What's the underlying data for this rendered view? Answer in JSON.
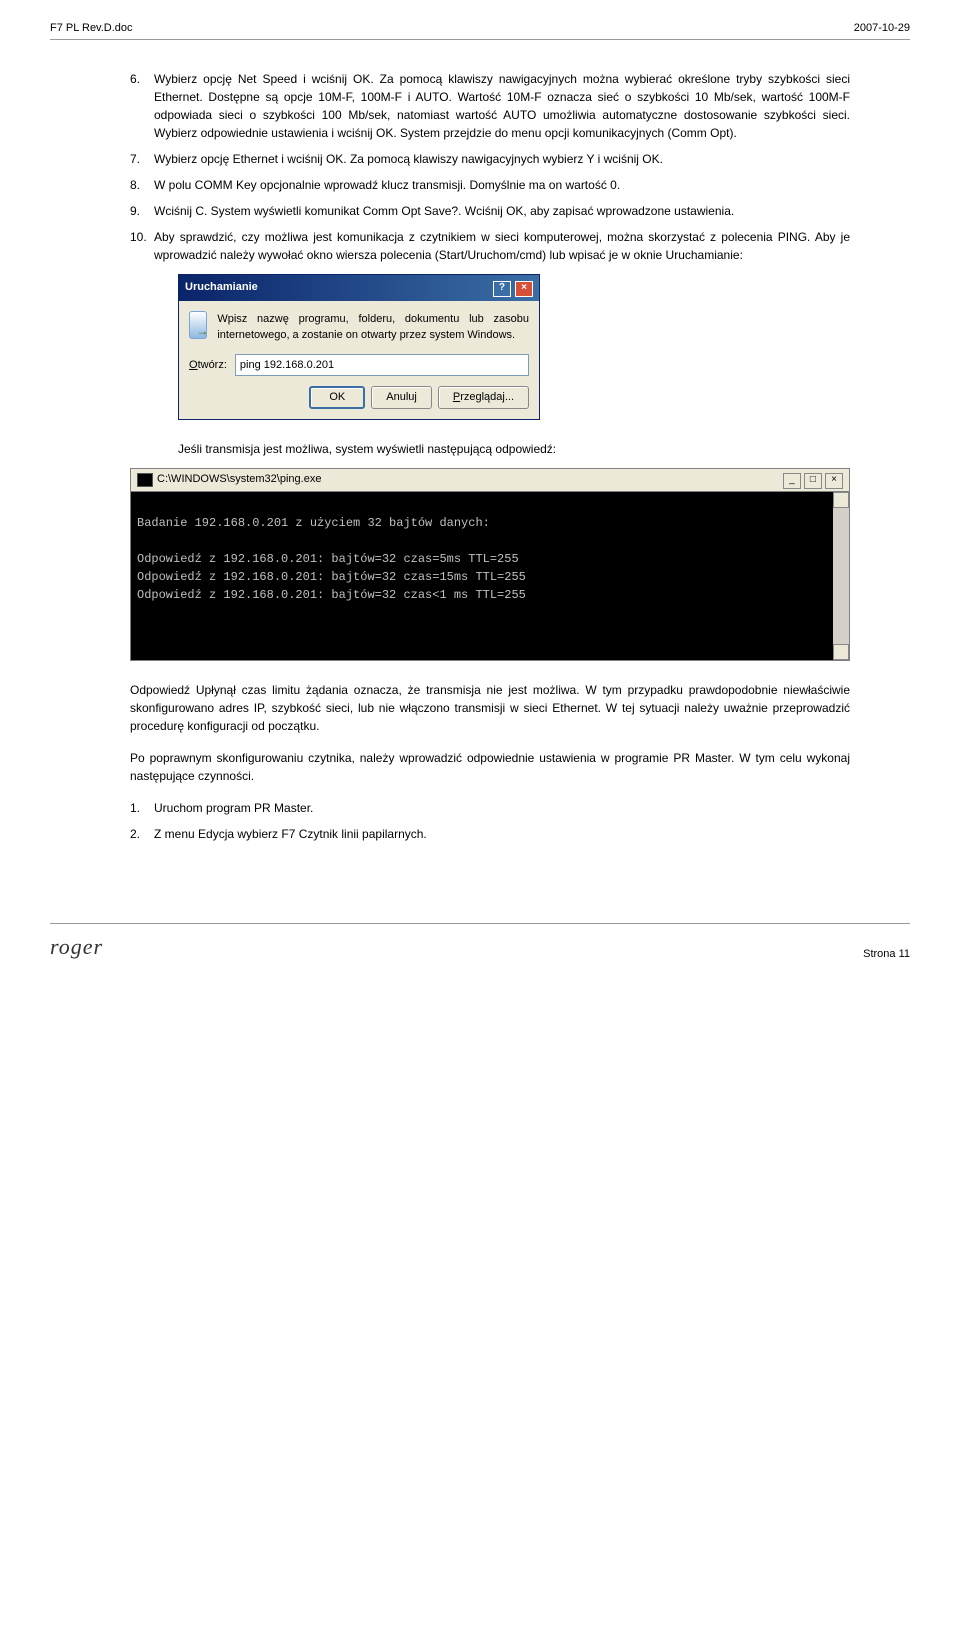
{
  "header": {
    "left": "F7 PL Rev.D.doc",
    "right": "2007-10-29"
  },
  "items": {
    "i6": "Wybierz opcję Net Speed i wciśnij OK. Za pomocą klawiszy nawigacyjnych można wybierać określone tryby szybkości sieci Ethernet. Dostępne są opcje 10M-F, 100M-F i AUTO. Wartość 10M-F oznacza sieć o szybkości 10 Mb/sek, wartość 100M-F odpowiada sieci o szybkości 100 Mb/sek, natomiast wartość AUTO umożliwia automatyczne dostosowanie szybkości sieci. Wybierz odpowiednie ustawienia i wciśnij OK. System przejdzie do menu opcji komunikacyjnych (Comm Opt).",
    "i7": "Wybierz opcję Ethernet i wciśnij OK. Za pomocą klawiszy nawigacyjnych wybierz Y i wciśnij OK.",
    "i8": "W polu COMM Key opcjonalnie wprowadź klucz transmisji. Domyślnie ma on wartość 0.",
    "i9": "Wciśnij C. System wyświetli komunikat Comm Opt Save?. Wciśnij OK, aby zapisać wprowadzone ustawienia.",
    "i10": "Aby sprawdzić, czy możliwa jest komunikacja z czytnikiem w sieci komputerowej, można skorzystać z polecenia PING. Aby je wprowadzić należy wywołać okno wiersza polecenia (Start/Uruchom/cmd) lub wpisać je w oknie Uruchamianie:"
  },
  "runDialog": {
    "title": "Uruchamianie",
    "desc": "Wpisz nazwę programu, folderu, dokumentu lub zasobu internetowego, a zostanie on otwarty przez system Windows.",
    "label": "Otwórz:",
    "value": "ping 192.168.0.201",
    "ok": "OK",
    "cancel": "Anuluj",
    "browse": "Przeglądaj..."
  },
  "responseLabel": "Jeśli transmisja jest możliwa, system wyświetli następującą odpowiedź:",
  "cmd": {
    "title": "C:\\WINDOWS\\system32\\ping.exe",
    "body": "\nBadanie 192.168.0.201 z użyciem 32 bajtów danych:\n\nOdpowiedź z 192.168.0.201: bajtów=32 czas=5ms TTL=255\nOdpowiedź z 192.168.0.201: bajtów=32 czas=15ms TTL=255\nOdpowiedź z 192.168.0.201: bajtów=32 czas<1 ms TTL=255"
  },
  "after1": "Odpowiedź Upłynął czas limitu żądania oznacza, że transmisja nie jest możliwa. W tym przypadku prawdopodobnie niewłaściwie skonfigurowano adres IP, szybkość sieci, lub nie włączono transmisji w sieci Ethernet. W tej sytuacji należy uważnie przeprowadzić procedurę konfiguracji od początku.",
  "after2": "Po poprawnym skonfigurowaniu czytnika, należy wprowadzić odpowiednie ustawienia w programie PR Master. W tym celu wykonaj następujące czynności.",
  "sub": {
    "s1": "Uruchom program PR Master.",
    "s2": "Z menu Edycja wybierz F7 Czytnik linii papilarnych."
  },
  "footer": {
    "logo": "roger",
    "page": "Strona 11"
  }
}
